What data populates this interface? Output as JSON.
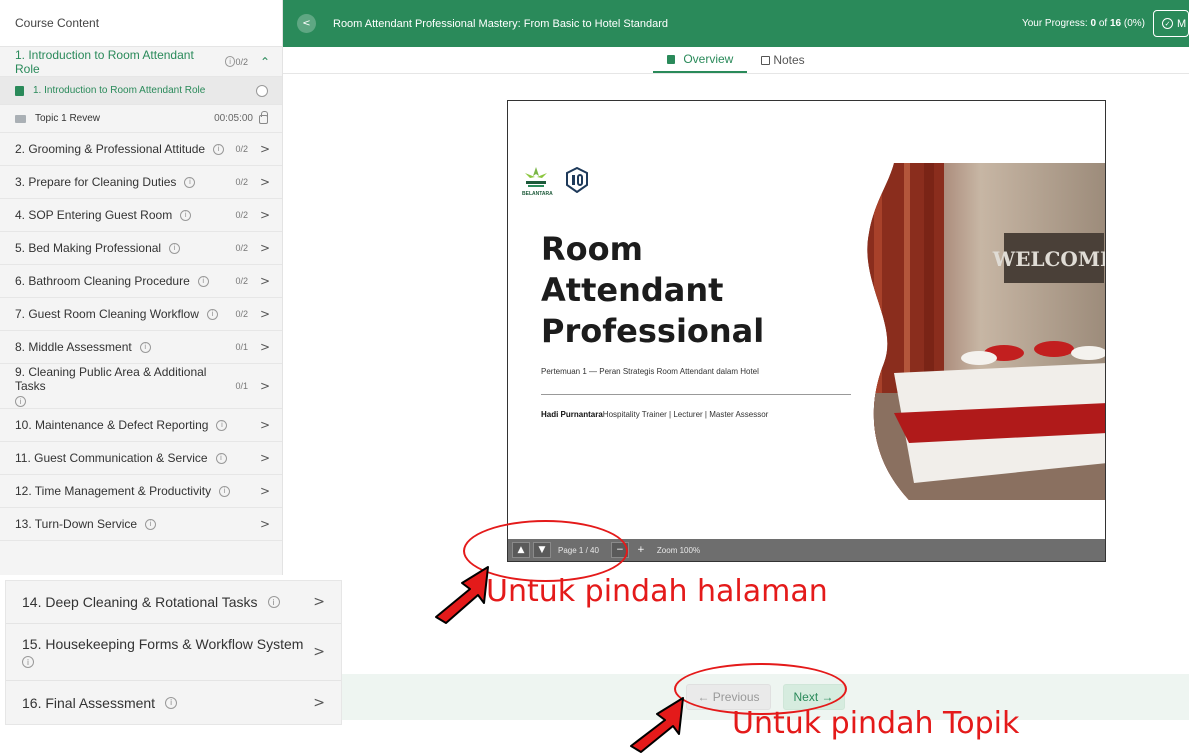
{
  "sidebar": {
    "header": "Course Content",
    "active_module": {
      "title": "1. Introduction to Room Attendant Role",
      "count": "0/2"
    },
    "lessons": [
      {
        "title": "1. Introduction to Room Attendant Role"
      },
      {
        "title": "Topic 1 Revew",
        "duration": "00:05:00"
      }
    ],
    "modules": [
      {
        "title": "2. Grooming & Professional Attitude",
        "count": "0/2"
      },
      {
        "title": "3. Prepare for Cleaning Duties",
        "count": "0/2"
      },
      {
        "title": "4. SOP Entering Guest Room",
        "count": "0/2"
      },
      {
        "title": "5. Bed Making Professional",
        "count": "0/2"
      },
      {
        "title": "6. Bathroom Cleaning Procedure",
        "count": "0/2"
      },
      {
        "title": "7. Guest Room Cleaning Workflow",
        "count": "0/2"
      },
      {
        "title": "8. Middle Assessment",
        "count": "0/1"
      },
      {
        "title": "9. Cleaning Public Area & Additional Tasks",
        "count": "0/1"
      },
      {
        "title": "10. Maintenance & Defect Reporting",
        "count": ""
      },
      {
        "title": "11. Guest Communication & Service",
        "count": ""
      },
      {
        "title": "12. Time Management & Productivity",
        "count": ""
      },
      {
        "title": "13. Turn-Down Service",
        "count": ""
      }
    ],
    "modules_zoomed": [
      {
        "title": "14. Deep Cleaning & Rotational Tasks"
      },
      {
        "title": "15. Housekeeping Forms & Workflow System"
      },
      {
        "title": "16. Final Assessment"
      }
    ]
  },
  "topbar": {
    "course_title": "Room Attendant Professional Mastery: From Basic to Hotel Standard",
    "progress_label": "Your Progress:",
    "progress_done": "0",
    "progress_of": "of",
    "progress_total": "16",
    "progress_pct": "(0%)",
    "mark_label": "M"
  },
  "tabs": {
    "overview": "Overview",
    "notes": "Notes"
  },
  "slide": {
    "brand": "BELANTARA",
    "title_lines": [
      "Room",
      "Attendant",
      "Professional"
    ],
    "subtitle": "Pertemuan 1 — Peran Strategis Room Attendant dalam Hotel",
    "author_name": "Hadi Purnantara",
    "author_role": "Hospitality Trainer | Lecturer | Master Assessor",
    "sign_text": "WELCOME"
  },
  "viewer_toolbar": {
    "page": "Page 1 / 40",
    "zoom": "Zoom 100%"
  },
  "nav": {
    "previous": "← Previous",
    "next": "Next →"
  },
  "annotations": {
    "page_nav": "Untuk pindah halaman",
    "topic_nav": "Untuk pindah Topik"
  },
  "colors": {
    "brand_green": "#2a8a5a",
    "annotation_red": "#e41a1a"
  }
}
